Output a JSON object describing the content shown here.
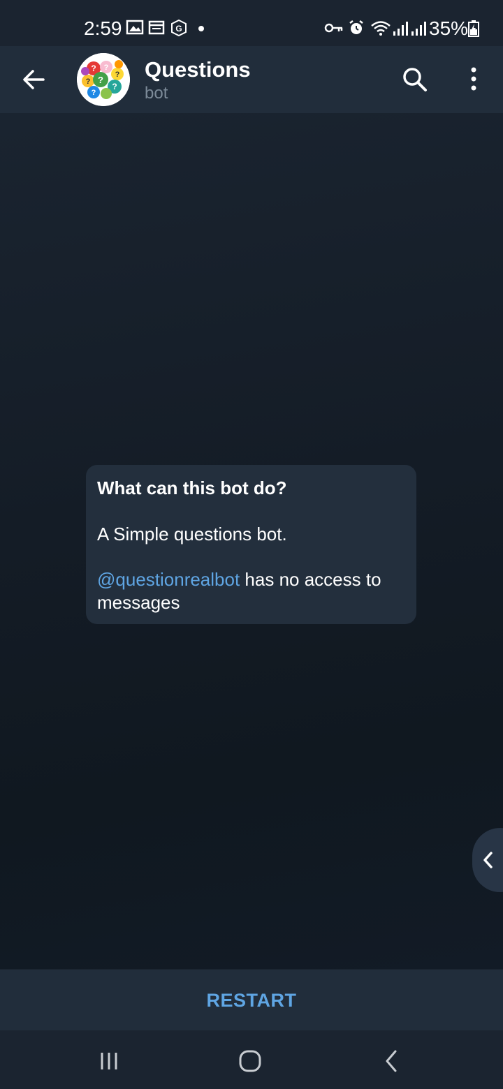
{
  "status_bar": {
    "time": "2:59",
    "battery": "35%",
    "icons": [
      "image-icon",
      "calendar-icon",
      "g-icon",
      "dot-icon",
      "key-icon",
      "alarm-icon",
      "wifi-icon",
      "signal-icon",
      "signal-icon",
      "battery-icon"
    ]
  },
  "header": {
    "title": "Questions",
    "subtitle": "bot",
    "icons": [
      "back-arrow-icon",
      "avatar",
      "search-icon",
      "more-vertical-icon"
    ]
  },
  "info_bubble": {
    "title": "What can this bot do?",
    "description": "A Simple questions bot.",
    "handle": "@questionrealbot",
    "access_text": " has no access to messages"
  },
  "bottom": {
    "restart_label": "RESTART"
  },
  "nav": {
    "icons": [
      "recent-apps-icon",
      "home-icon",
      "back-icon"
    ]
  },
  "colors": {
    "accent": "#5fa5e3",
    "header_bg": "#212d3b",
    "bubble_bg": "#232f3d"
  }
}
